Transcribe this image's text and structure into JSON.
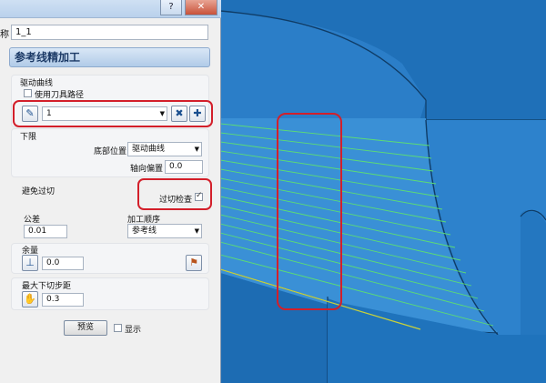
{
  "window": {
    "help_label": "?",
    "close_label": "✕"
  },
  "name_field": {
    "label": "称",
    "value": "1_1"
  },
  "panel_title": "参考线精加工",
  "drive_curve": {
    "title": "驱动曲线",
    "use_toolpath_label": "使用刀具路径",
    "curve_value": "1"
  },
  "lower_limit": {
    "title": "下限",
    "bottom_position_label": "底部位置",
    "bottom_position_value": "驱动曲线",
    "axial_offset_label": "轴向偏置",
    "axial_offset_value": "0.0"
  },
  "gouge": {
    "title": "避免过切",
    "check_label": "过切检查",
    "checked": true
  },
  "tolerance": {
    "label": "公差",
    "value": "0.01"
  },
  "order": {
    "label": "加工顺序",
    "value": "参考线"
  },
  "allowance": {
    "label": "余量",
    "value": "0.0"
  },
  "stepdown": {
    "label": "最大下切步距",
    "value": "0.3"
  },
  "footer": {
    "preview_label": "预览",
    "display_label": "显示",
    "display_checked": false
  },
  "colors": {
    "viewport_bg": "#2275bd",
    "toolpath": "#5cdc74",
    "highlight": "#d31f2a",
    "part": "#2a7fc6"
  }
}
